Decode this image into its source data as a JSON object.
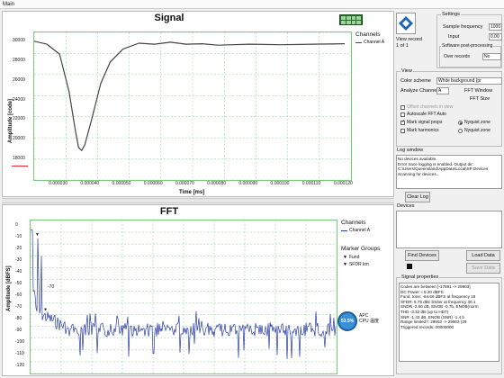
{
  "menubar": {
    "item": "Main"
  },
  "signal": {
    "title": "Signal",
    "ylabel": "Amplitude [code]",
    "xlabel": "Time [ms]",
    "yticks": [
      "30000",
      "28000",
      "26000",
      "24000",
      "22000",
      "20000",
      "18000"
    ],
    "xticks": [
      "0.000030",
      "0.000040",
      "0.000050",
      "0.000060",
      "0.000070",
      "0.000080",
      "0.000090",
      "0.000100",
      "0.000110",
      "0.000120"
    ],
    "legend_title": "Channels",
    "legend_item": "Channel A",
    "colors": {
      "trace": "#444444",
      "grid": "#8fd18f"
    },
    "chart_data": {
      "type": "line",
      "ylim": [
        16000,
        31000
      ],
      "xlim": [
        2.2e-05,
        0.000122
      ],
      "x": [
        2.2e-05,
        2.6e-05,
        3e-05,
        3.3e-05,
        3.5e-05,
        3.6e-05,
        3.7e-05,
        3.8e-05,
        4e-05,
        4.3e-05,
        4.6e-05,
        5e-05,
        5.5e-05,
        6e-05,
        6.5e-05,
        7e-05,
        7.5e-05,
        8e-05,
        9e-05,
        0.0001,
        0.00011,
        0.00012
      ],
      "values": [
        30100,
        29800,
        28800,
        25000,
        21000,
        19300,
        19000,
        19600,
        22000,
        25800,
        28000,
        29300,
        29900,
        29800,
        30000,
        29800,
        29850,
        29700,
        29800,
        29750,
        29800,
        29850
      ]
    }
  },
  "fft": {
    "title": "FFT",
    "ylabel": "Amplitude [dBFS]",
    "yticks": [
      "0",
      "-10",
      "-20",
      "-30",
      "-40",
      "-50",
      "-60",
      "-70",
      "-80",
      "-90",
      "-100",
      "-110",
      "-120"
    ],
    "legend_title": "Channels",
    "legend_item": "Channel A",
    "marker_title": "Marker Groups",
    "marker_items": [
      "Fund",
      "SFDR km"
    ],
    "annotation": "-70",
    "colors": {
      "trace": "#2a3ca8",
      "grid": "#8fd18f"
    },
    "chart_data": {
      "type": "line",
      "ylim": [
        -125,
        5
      ],
      "description_series": [
        {
          "name": "Channel A",
          "peaks_db": [
            -3,
            -10,
            -45,
            -62,
            -70,
            -72,
            -78,
            -80,
            -85,
            -90,
            -88,
            -92
          ]
        }
      ]
    }
  },
  "cpu_badge": {
    "value": "53.5%",
    "line1": "APC",
    "line2": "CPU 温度"
  },
  "settings": {
    "view_record_label": "View record",
    "view_record_value": "1 of 1",
    "title": "Settings",
    "sample_freq_label": "Sample frequency",
    "sample_freq_value": "1000",
    "input_label": "Input",
    "input_value": "0.00",
    "swpp_title": "Software post-processing",
    "over_records_label": "Over records",
    "over_records_value": "No"
  },
  "view": {
    "title": "View",
    "color_scheme_label": "Color scheme",
    "color_scheme_value": "White background (pr",
    "analyze_label": "Analyze Channel",
    "analyze_value": "A",
    "fft_window_label": "FFT Window",
    "fft_size_label": "FFT Size",
    "offset_label": "Offset channels in view",
    "autoscale_label": "Autoscale FFT Auto",
    "mark_props_label": "Mark signal props",
    "mark_harm_label": "Mark harmonics",
    "nyq1_label": "Nyquist zone",
    "nyq2_label": "Nyquist zone"
  },
  "log": {
    "title": "Log window",
    "lines": [
      "No devices available.",
      "Error trace logging is enabled. Output dir:",
      "C:\\Users\\Queensland\\AppData\\Local\\SP Devices",
      "Scanning for devices..."
    ],
    "clear_label": "Clear Log"
  },
  "devices": {
    "title": "Devices",
    "find_label": "Find Devices",
    "load_label": "Load Data",
    "save_label": "Save Data"
  },
  "signal_props": {
    "title": "Signal properties",
    "lines": [
      "Codes are between [-17891 -> 29903]",
      "DC Power ≈ 5.20 dBFS",
      "Fund. tone: -64.66 dBFS at frequency 18",
      "SFDR: 5.75 dBc limiter at frequency 36.1",
      "SNDR -2.60 dB, ENOB -0.7b, ENOB(norm",
      "THD -3.32 dB (up to HD7)",
      "SNR -1.43 dB, ENOB (SNR) -1.4 b",
      "Range limited?: 29903 -> 29903 (29",
      "Triggered records: 00000000"
    ]
  }
}
